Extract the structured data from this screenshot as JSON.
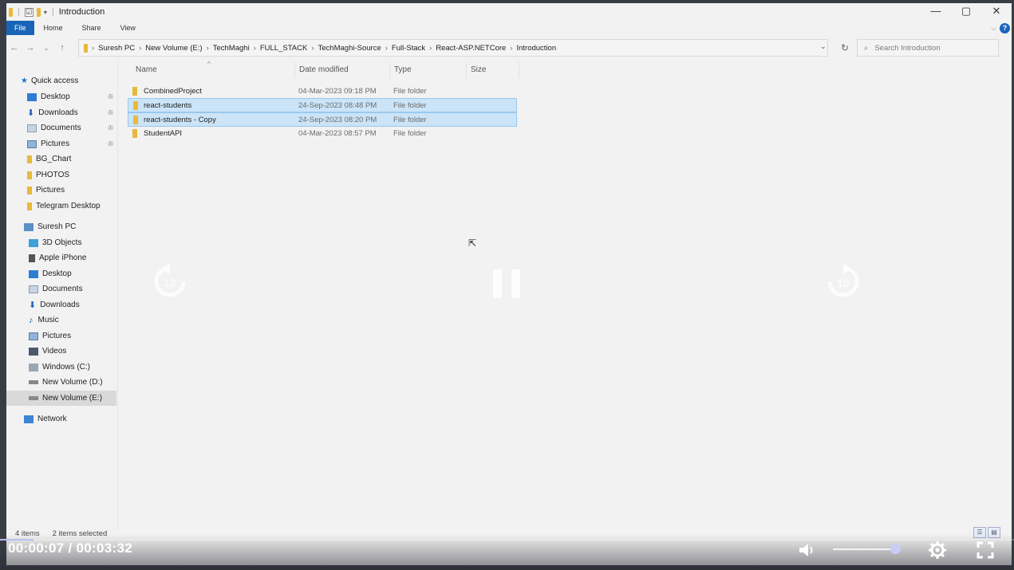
{
  "window": {
    "title": "Introduction",
    "controls": {
      "minimize": "—",
      "maximize": "▢",
      "close": "✕"
    }
  },
  "ribbon": {
    "tabs": [
      "File",
      "Home",
      "Share",
      "View"
    ]
  },
  "address": {
    "breadcrumbs": [
      "Suresh PC",
      "New Volume (E:)",
      "TechMaghi",
      "FULL_STACK",
      "TechMaghi-Source",
      "Full-Stack",
      "React-ASP.NETCore",
      "Introduction"
    ],
    "search_placeholder": "Search Introduction"
  },
  "navpane": {
    "quick_access": "Quick access",
    "quick_items": [
      "Desktop",
      "Downloads",
      "Documents",
      "Pictures",
      "BG_Chart",
      "PHOTOS",
      "Pictures",
      "Telegram Desktop"
    ],
    "this_pc": "Suresh PC",
    "pc_items": [
      "3D Objects",
      "Apple iPhone",
      "Desktop",
      "Documents",
      "Downloads",
      "Music",
      "Pictures",
      "Videos",
      "Windows (C:)",
      "New Volume (D:)",
      "New Volume (E:)"
    ],
    "network": "Network"
  },
  "filelist": {
    "columns": {
      "name": "Name",
      "date": "Date modified",
      "type": "Type",
      "size": "Size"
    },
    "rows": [
      {
        "name": "CombinedProject",
        "date": "04-Mar-2023 09:18 PM",
        "type": "File folder",
        "selected": false
      },
      {
        "name": "react-students",
        "date": "24-Sep-2023 08:48 PM",
        "type": "File folder",
        "selected": true
      },
      {
        "name": "react-students - Copy",
        "date": "24-Sep-2023 08:20 PM",
        "type": "File folder",
        "selected": true
      },
      {
        "name": "StudentAPI",
        "date": "04-Mar-2023 08:57 PM",
        "type": "File folder",
        "selected": false
      }
    ]
  },
  "status": {
    "item_count": "4 items",
    "selection": "2 items selected"
  },
  "player": {
    "timecode": "00:00:07  / 00:03:32",
    "skip_seconds": "10",
    "progress_fraction": 0.033,
    "volume_fraction": 0.95
  }
}
